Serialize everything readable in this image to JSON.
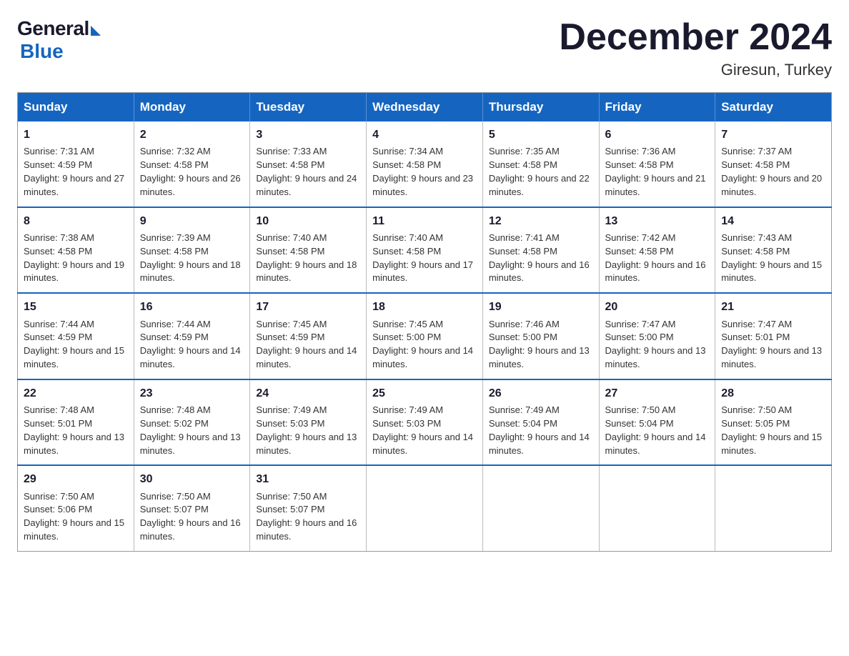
{
  "logo": {
    "general": "General",
    "blue": "Blue"
  },
  "title": "December 2024",
  "location": "Giresun, Turkey",
  "days_of_week": [
    "Sunday",
    "Monday",
    "Tuesday",
    "Wednesday",
    "Thursday",
    "Friday",
    "Saturday"
  ],
  "weeks": [
    [
      {
        "day": "1",
        "sunrise": "7:31 AM",
        "sunset": "4:59 PM",
        "daylight": "9 hours and 27 minutes."
      },
      {
        "day": "2",
        "sunrise": "7:32 AM",
        "sunset": "4:58 PM",
        "daylight": "9 hours and 26 minutes."
      },
      {
        "day": "3",
        "sunrise": "7:33 AM",
        "sunset": "4:58 PM",
        "daylight": "9 hours and 24 minutes."
      },
      {
        "day": "4",
        "sunrise": "7:34 AM",
        "sunset": "4:58 PM",
        "daylight": "9 hours and 23 minutes."
      },
      {
        "day": "5",
        "sunrise": "7:35 AM",
        "sunset": "4:58 PM",
        "daylight": "9 hours and 22 minutes."
      },
      {
        "day": "6",
        "sunrise": "7:36 AM",
        "sunset": "4:58 PM",
        "daylight": "9 hours and 21 minutes."
      },
      {
        "day": "7",
        "sunrise": "7:37 AM",
        "sunset": "4:58 PM",
        "daylight": "9 hours and 20 minutes."
      }
    ],
    [
      {
        "day": "8",
        "sunrise": "7:38 AM",
        "sunset": "4:58 PM",
        "daylight": "9 hours and 19 minutes."
      },
      {
        "day": "9",
        "sunrise": "7:39 AM",
        "sunset": "4:58 PM",
        "daylight": "9 hours and 18 minutes."
      },
      {
        "day": "10",
        "sunrise": "7:40 AM",
        "sunset": "4:58 PM",
        "daylight": "9 hours and 18 minutes."
      },
      {
        "day": "11",
        "sunrise": "7:40 AM",
        "sunset": "4:58 PM",
        "daylight": "9 hours and 17 minutes."
      },
      {
        "day": "12",
        "sunrise": "7:41 AM",
        "sunset": "4:58 PM",
        "daylight": "9 hours and 16 minutes."
      },
      {
        "day": "13",
        "sunrise": "7:42 AM",
        "sunset": "4:58 PM",
        "daylight": "9 hours and 16 minutes."
      },
      {
        "day": "14",
        "sunrise": "7:43 AM",
        "sunset": "4:58 PM",
        "daylight": "9 hours and 15 minutes."
      }
    ],
    [
      {
        "day": "15",
        "sunrise": "7:44 AM",
        "sunset": "4:59 PM",
        "daylight": "9 hours and 15 minutes."
      },
      {
        "day": "16",
        "sunrise": "7:44 AM",
        "sunset": "4:59 PM",
        "daylight": "9 hours and 14 minutes."
      },
      {
        "day": "17",
        "sunrise": "7:45 AM",
        "sunset": "4:59 PM",
        "daylight": "9 hours and 14 minutes."
      },
      {
        "day": "18",
        "sunrise": "7:45 AM",
        "sunset": "5:00 PM",
        "daylight": "9 hours and 14 minutes."
      },
      {
        "day": "19",
        "sunrise": "7:46 AM",
        "sunset": "5:00 PM",
        "daylight": "9 hours and 13 minutes."
      },
      {
        "day": "20",
        "sunrise": "7:47 AM",
        "sunset": "5:00 PM",
        "daylight": "9 hours and 13 minutes."
      },
      {
        "day": "21",
        "sunrise": "7:47 AM",
        "sunset": "5:01 PM",
        "daylight": "9 hours and 13 minutes."
      }
    ],
    [
      {
        "day": "22",
        "sunrise": "7:48 AM",
        "sunset": "5:01 PM",
        "daylight": "9 hours and 13 minutes."
      },
      {
        "day": "23",
        "sunrise": "7:48 AM",
        "sunset": "5:02 PM",
        "daylight": "9 hours and 13 minutes."
      },
      {
        "day": "24",
        "sunrise": "7:49 AM",
        "sunset": "5:03 PM",
        "daylight": "9 hours and 13 minutes."
      },
      {
        "day": "25",
        "sunrise": "7:49 AM",
        "sunset": "5:03 PM",
        "daylight": "9 hours and 14 minutes."
      },
      {
        "day": "26",
        "sunrise": "7:49 AM",
        "sunset": "5:04 PM",
        "daylight": "9 hours and 14 minutes."
      },
      {
        "day": "27",
        "sunrise": "7:50 AM",
        "sunset": "5:04 PM",
        "daylight": "9 hours and 14 minutes."
      },
      {
        "day": "28",
        "sunrise": "7:50 AM",
        "sunset": "5:05 PM",
        "daylight": "9 hours and 15 minutes."
      }
    ],
    [
      {
        "day": "29",
        "sunrise": "7:50 AM",
        "sunset": "5:06 PM",
        "daylight": "9 hours and 15 minutes."
      },
      {
        "day": "30",
        "sunrise": "7:50 AM",
        "sunset": "5:07 PM",
        "daylight": "9 hours and 16 minutes."
      },
      {
        "day": "31",
        "sunrise": "7:50 AM",
        "sunset": "5:07 PM",
        "daylight": "9 hours and 16 minutes."
      },
      null,
      null,
      null,
      null
    ]
  ],
  "labels": {
    "sunrise": "Sunrise:",
    "sunset": "Sunset:",
    "daylight": "Daylight:"
  }
}
